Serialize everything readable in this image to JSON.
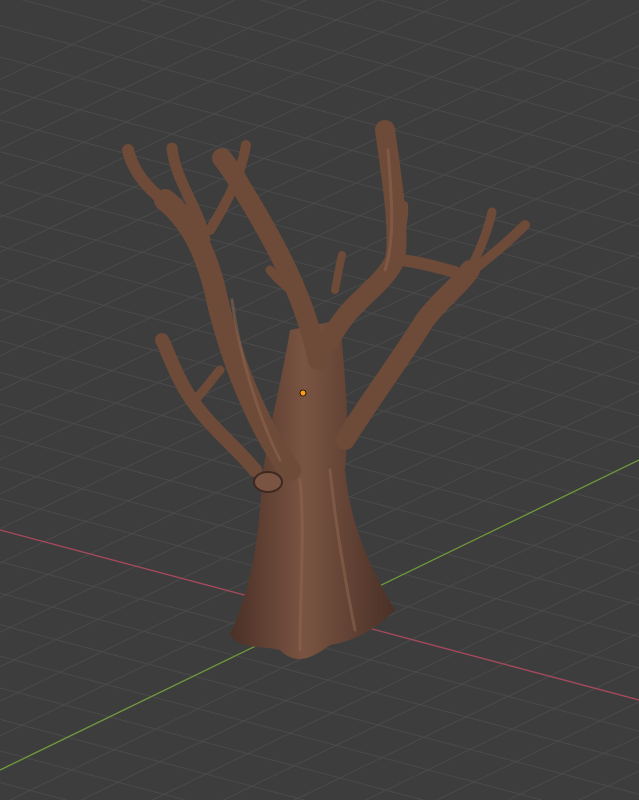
{
  "viewport": {
    "background": "#3d3d3d",
    "grid_color": "#4a4a4a",
    "x_axis_color": "#a8485c",
    "y_axis_color": "#6f9a3a",
    "origin_color": "#ff9a1f"
  },
  "object": {
    "kind": "tree-sculpt",
    "base_color": "#6e4a38",
    "shadow_color": "#3e2820",
    "highlight_color": "#8e6650"
  }
}
